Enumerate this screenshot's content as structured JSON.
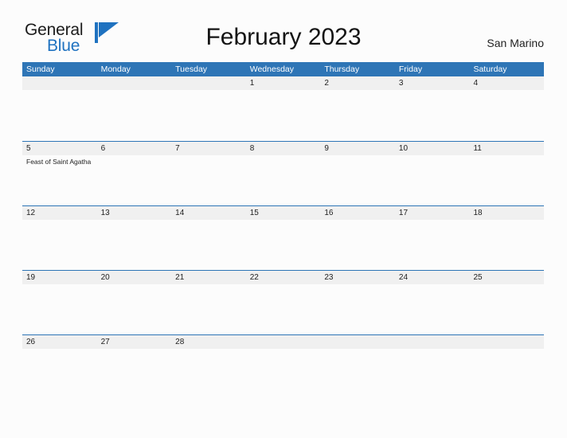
{
  "brand": {
    "word1": "General",
    "word2": "Blue",
    "flag_icon": "blue-flag-icon",
    "accent_color": "#1f72c0"
  },
  "header": {
    "title": "February 2023",
    "locale": "San Marino"
  },
  "colors": {
    "header_blue": "#2e75b6",
    "date_band": "#f0f0f0",
    "page_background": "#fcfcfc",
    "text": "#1e1e1e"
  },
  "calendar": {
    "month": "February",
    "year": "2023",
    "weekday_headers": [
      "Sunday",
      "Monday",
      "Tuesday",
      "Wednesday",
      "Thursday",
      "Friday",
      "Saturday"
    ],
    "weeks": [
      {
        "days": [
          {
            "number": "",
            "events": []
          },
          {
            "number": "",
            "events": []
          },
          {
            "number": "",
            "events": []
          },
          {
            "number": "1",
            "events": []
          },
          {
            "number": "2",
            "events": []
          },
          {
            "number": "3",
            "events": []
          },
          {
            "number": "4",
            "events": []
          }
        ]
      },
      {
        "days": [
          {
            "number": "5",
            "events": [
              "Feast of Saint Agatha"
            ]
          },
          {
            "number": "6",
            "events": []
          },
          {
            "number": "7",
            "events": []
          },
          {
            "number": "8",
            "events": []
          },
          {
            "number": "9",
            "events": []
          },
          {
            "number": "10",
            "events": []
          },
          {
            "number": "11",
            "events": []
          }
        ]
      },
      {
        "days": [
          {
            "number": "12",
            "events": []
          },
          {
            "number": "13",
            "events": []
          },
          {
            "number": "14",
            "events": []
          },
          {
            "number": "15",
            "events": []
          },
          {
            "number": "16",
            "events": []
          },
          {
            "number": "17",
            "events": []
          },
          {
            "number": "18",
            "events": []
          }
        ]
      },
      {
        "days": [
          {
            "number": "19",
            "events": []
          },
          {
            "number": "20",
            "events": []
          },
          {
            "number": "21",
            "events": []
          },
          {
            "number": "22",
            "events": []
          },
          {
            "number": "23",
            "events": []
          },
          {
            "number": "24",
            "events": []
          },
          {
            "number": "25",
            "events": []
          }
        ]
      },
      {
        "days": [
          {
            "number": "26",
            "events": []
          },
          {
            "number": "27",
            "events": []
          },
          {
            "number": "28",
            "events": []
          },
          {
            "number": "",
            "events": []
          },
          {
            "number": "",
            "events": []
          },
          {
            "number": "",
            "events": []
          },
          {
            "number": "",
            "events": []
          }
        ]
      }
    ]
  }
}
